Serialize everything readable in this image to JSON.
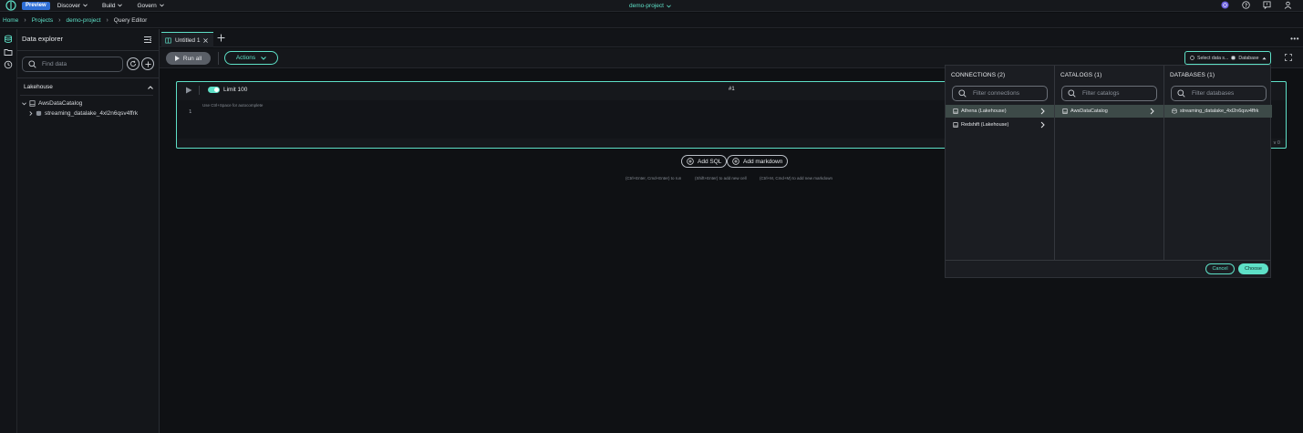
{
  "topbar": {
    "preview_badge": "Preview",
    "nav": [
      {
        "label": "Discover"
      },
      {
        "label": "Build"
      },
      {
        "label": "Govern"
      }
    ],
    "project": "demo-project"
  },
  "breadcrumb": {
    "items": [
      "Home",
      "Projects",
      "demo-project"
    ],
    "current": "Query Editor"
  },
  "explorer": {
    "title": "Data explorer",
    "search_placeholder": "Find data",
    "section": "Lakehouse",
    "tree": {
      "catalog": "AwsDataCatalog",
      "database": "streaming_datalake_4xl2n6qsv4ffrk"
    }
  },
  "tabs": [
    {
      "label": "Untitled 1"
    }
  ],
  "toolbar": {
    "run_all": "Run all",
    "actions": "Actions",
    "datasource_label": "Select data s...",
    "database_label": "Database"
  },
  "cell": {
    "limit_label": "Limit 100",
    "cell_number": "#1",
    "hint": "Use Ctrl+Space for autocomplete",
    "line_number": "1",
    "row_count_partial": "v 0"
  },
  "add_buttons": {
    "add_sql": "Add SQL",
    "add_markdown": "Add markdown"
  },
  "shortcuts": [
    "(Ctrl+Enter, Cmd+Enter) to run",
    "(Shift+Enter) to add new cell",
    "(Ctrl+M, Cmd+M) to add new markdown"
  ],
  "picker": {
    "connections": {
      "title": "CONNECTIONS (2)",
      "placeholder": "Filter connections",
      "items": [
        "Athena (Lakehouse)",
        "Redshift (Lakehouse)"
      ]
    },
    "catalogs": {
      "title": "CATALOGS (1)",
      "placeholder": "Filter catalogs",
      "items": [
        "AwsDataCatalog"
      ]
    },
    "databases": {
      "title": "DATABASES (1)",
      "placeholder": "Filter databases",
      "items": [
        "streaming_datalake_4xl2n6qsv4ffrk"
      ]
    },
    "cancel": "Cancel",
    "choose": "Choose"
  },
  "colors": {
    "accent": "#5ee0c7",
    "background": "#0d0f12",
    "panel": "#1b1d22",
    "badge": "#2f6fd6"
  },
  "icons": [
    "logo-icon",
    "chevron-down-icon",
    "help-icon",
    "feedback-icon",
    "user-icon",
    "database-icon",
    "folder-icon",
    "history-icon",
    "collapse-panel-icon",
    "search-icon",
    "refresh-icon",
    "plus-icon",
    "chevron-right-icon",
    "catalog-icon",
    "tab-icon",
    "close-icon",
    "more-icon",
    "play-icon",
    "expand-icon"
  ]
}
